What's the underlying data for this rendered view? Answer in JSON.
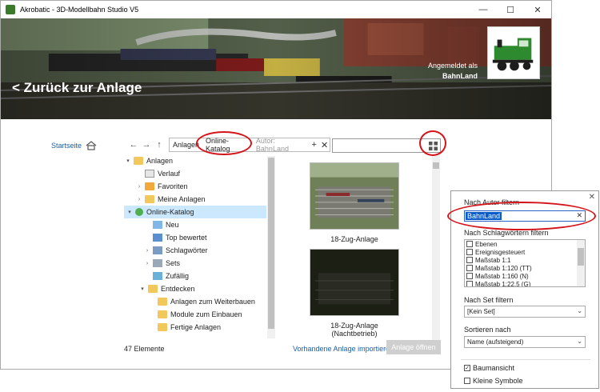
{
  "window": {
    "title": "Akrobatic - 3D-Modellbahn Studio V5",
    "minimize": "—",
    "maximize": "☐",
    "close": "✕"
  },
  "banner": {
    "back_label": "< Zurück zur Anlage",
    "login_label": "Angemeldet als",
    "login_user": "BahnLand"
  },
  "nav": {
    "home_label": "Startseite",
    "back": "←",
    "forward": "→",
    "up": "↑",
    "crumbs": [
      "Anlagen",
      "Online-Katalog",
      "Autor: BahnLand"
    ],
    "add": "+",
    "clear": "✕",
    "search_value": ""
  },
  "tree": [
    {
      "label": "Anlagen",
      "chev": "▾",
      "icon": "folder"
    },
    {
      "label": "Verlauf",
      "chev": "",
      "icon": "history"
    },
    {
      "label": "Favoriten",
      "chev": "›",
      "icon": "favorites"
    },
    {
      "label": "Meine Anlagen",
      "chev": "›",
      "icon": "folder"
    },
    {
      "label": "Online-Katalog",
      "chev": "▾",
      "icon": "globe"
    },
    {
      "label": "Neu",
      "chev": "",
      "icon": "new"
    },
    {
      "label": "Top bewertet",
      "chev": "",
      "icon": "top"
    },
    {
      "label": "Schlagwörter",
      "chev": "›",
      "icon": "tags"
    },
    {
      "label": "Sets",
      "chev": "›",
      "icon": "sets"
    },
    {
      "label": "Zufällig",
      "chev": "",
      "icon": "random"
    },
    {
      "label": "Entdecken",
      "chev": "▾",
      "icon": "folder"
    },
    {
      "label": "Anlagen zum Weiterbauen",
      "chev": "",
      "icon": "folder"
    },
    {
      "label": "Module zum Einbauen",
      "chev": "",
      "icon": "folder"
    },
    {
      "label": "Fertige Anlagen",
      "chev": "",
      "icon": "folder"
    }
  ],
  "cards": [
    {
      "label": "18-Zug-Anlage"
    },
    {
      "label": "18-Zug-Anlage (Nachtbetrieb)"
    }
  ],
  "footer": {
    "count": "47 Elemente",
    "import_link": "Vorhandene Anlage importieren",
    "open_button": "Anlage öffnen"
  },
  "filter_panel": {
    "close": "✕",
    "author_label": "Nach Autor filtern",
    "author_value": "BahnLand",
    "author_clear": "✕",
    "tags_label": "Nach Schlagwörtern filtern",
    "tags": [
      "Ebenen",
      "Ereignisgesteuert",
      "Maßstab 1:1",
      "Maßstab 1:120 (TT)",
      "Maßstab 1:160 (N)",
      "Maßstab 1:22,5 (G)"
    ],
    "set_label": "Nach Set filtern",
    "set_value": "[Kein Set]",
    "sort_label": "Sortieren nach",
    "sort_value": "Name (aufsteigend)",
    "dropdown": "⌄",
    "tree_view_label": "Baumansicht",
    "tree_view_checked": "✓",
    "small_icons_label": "Kleine Symbole"
  },
  "colors": {
    "link": "#1a5fa8",
    "highlight_ring": "#d4141a",
    "selection": "#cce8ff"
  }
}
